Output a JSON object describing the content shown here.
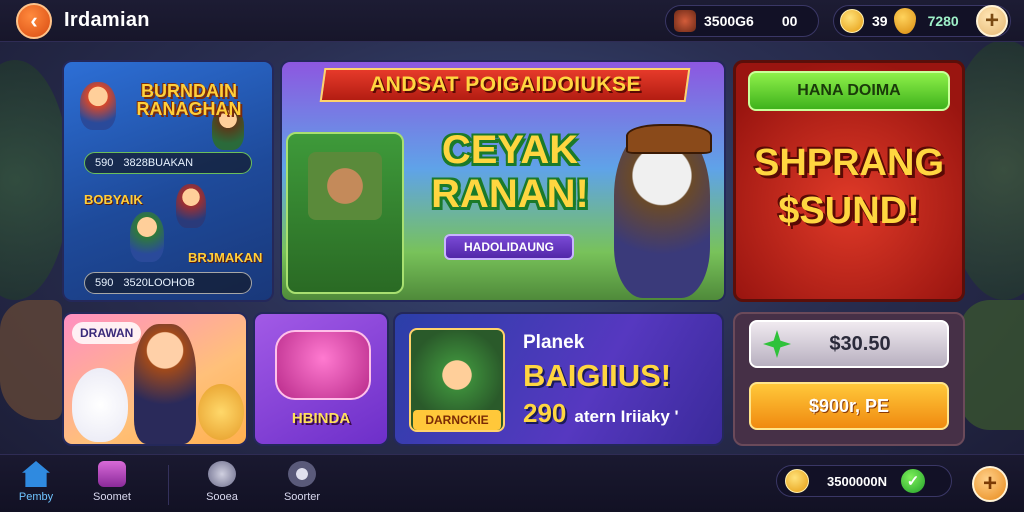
{
  "header": {
    "title": "Irdamian",
    "currency_1": {
      "value": "3500G6",
      "extra": "00"
    },
    "currency_2": {
      "value": "39",
      "gems": "7280"
    }
  },
  "cards": {
    "card1": {
      "title": "BURNDAIN RANAGHAN",
      "row1_a": "590",
      "row1_b": "3828BUAKAN",
      "sub1": "BOBYAIK",
      "sub2": "BRJMAKAN",
      "row2_a": "590",
      "row2_b": "3520LOOHOB"
    },
    "card2": {
      "banner": "ANDSAT POIGAIDOIUKSE",
      "headline_1": "CEYAK",
      "headline_2": "RANAN!",
      "sub_button": "HADOLIDAUNG"
    },
    "card3": {
      "button": "HANA DOIMA",
      "headline_1": "SHPRANG",
      "headline_2": "$SUND!"
    },
    "card4": {
      "tag": "DRAWAN"
    },
    "card5": {
      "label": "HBINDA"
    },
    "card6": {
      "pic_label": "DARNCKIE",
      "line1": "Planek",
      "line2": "BAIGIIUS!",
      "number": "290",
      "small": "atern Iriiaky '"
    },
    "card7": {
      "price1": "$30.50",
      "price2": "$900r, PE"
    }
  },
  "bottom_nav": [
    {
      "label": "Pemby",
      "active": true
    },
    {
      "label": "Soomet"
    },
    {
      "label": "Sooea"
    },
    {
      "label": "Soorter"
    }
  ],
  "bottom_currency": {
    "value": "3500000N"
  },
  "colors": {
    "accent_orange": "#f08a10",
    "accent_green": "#3fb21c",
    "accent_red": "#b31d12",
    "gold_text": "#ffd640"
  },
  "icons": [
    "back-arrow-icon",
    "hero-avatar-icon",
    "coin-icon",
    "shield-icon",
    "plus-icon",
    "gem-icon",
    "home-icon",
    "shop-icon",
    "chat-icon",
    "social-icon",
    "check-icon"
  ]
}
